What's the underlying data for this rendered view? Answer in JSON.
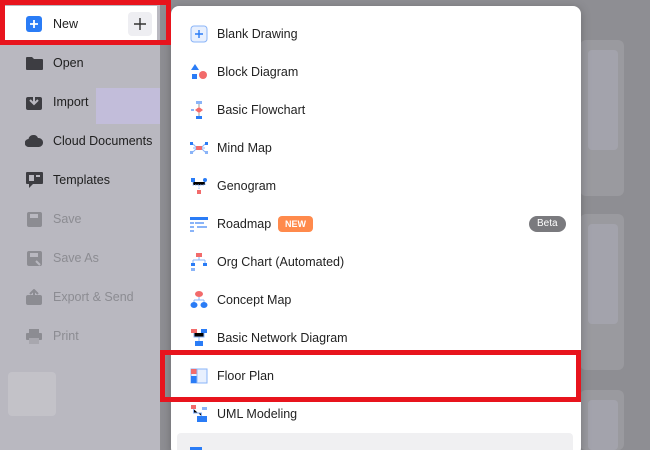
{
  "sidebar": {
    "new": {
      "label": "New"
    },
    "items": [
      {
        "label": "Open",
        "icon": "folder-icon",
        "enabled": true
      },
      {
        "label": "Import",
        "icon": "import-icon",
        "enabled": true
      },
      {
        "label": "Cloud Documents",
        "icon": "cloud-icon",
        "enabled": true
      },
      {
        "label": "Templates",
        "icon": "templates-icon",
        "enabled": true
      },
      {
        "label": "Save",
        "icon": "save-icon",
        "enabled": false
      },
      {
        "label": "Save As",
        "icon": "save-as-icon",
        "enabled": false
      },
      {
        "label": "Export & Send",
        "icon": "export-icon",
        "enabled": false
      },
      {
        "label": "Print",
        "icon": "print-icon",
        "enabled": false
      }
    ]
  },
  "menu": {
    "items": [
      {
        "label": "Blank Drawing",
        "icon": "blank-drawing-icon"
      },
      {
        "label": "Block Diagram",
        "icon": "block-diagram-icon"
      },
      {
        "label": "Basic Flowchart",
        "icon": "basic-flowchart-icon"
      },
      {
        "label": "Mind Map",
        "icon": "mind-map-icon"
      },
      {
        "label": "Genogram",
        "icon": "genogram-icon"
      },
      {
        "label": "Roadmap",
        "icon": "roadmap-icon",
        "badge": "NEW",
        "tag": "Beta"
      },
      {
        "label": "Org Chart (Automated)",
        "icon": "org-chart-icon"
      },
      {
        "label": "Concept Map",
        "icon": "concept-map-icon"
      },
      {
        "label": "Basic Network Diagram",
        "icon": "network-diagram-icon"
      },
      {
        "label": "Floor Plan",
        "icon": "floor-plan-icon"
      },
      {
        "label": "UML Modeling",
        "icon": "uml-modeling-icon"
      },
      {
        "label": "",
        "icon": "gantt-chart-icon"
      }
    ]
  },
  "colors": {
    "highlight_red": "#e8141d",
    "accent_blue": "#2a7cf6",
    "new_badge": "#ff8a4c",
    "beta_badge": "#7a7a7e"
  }
}
